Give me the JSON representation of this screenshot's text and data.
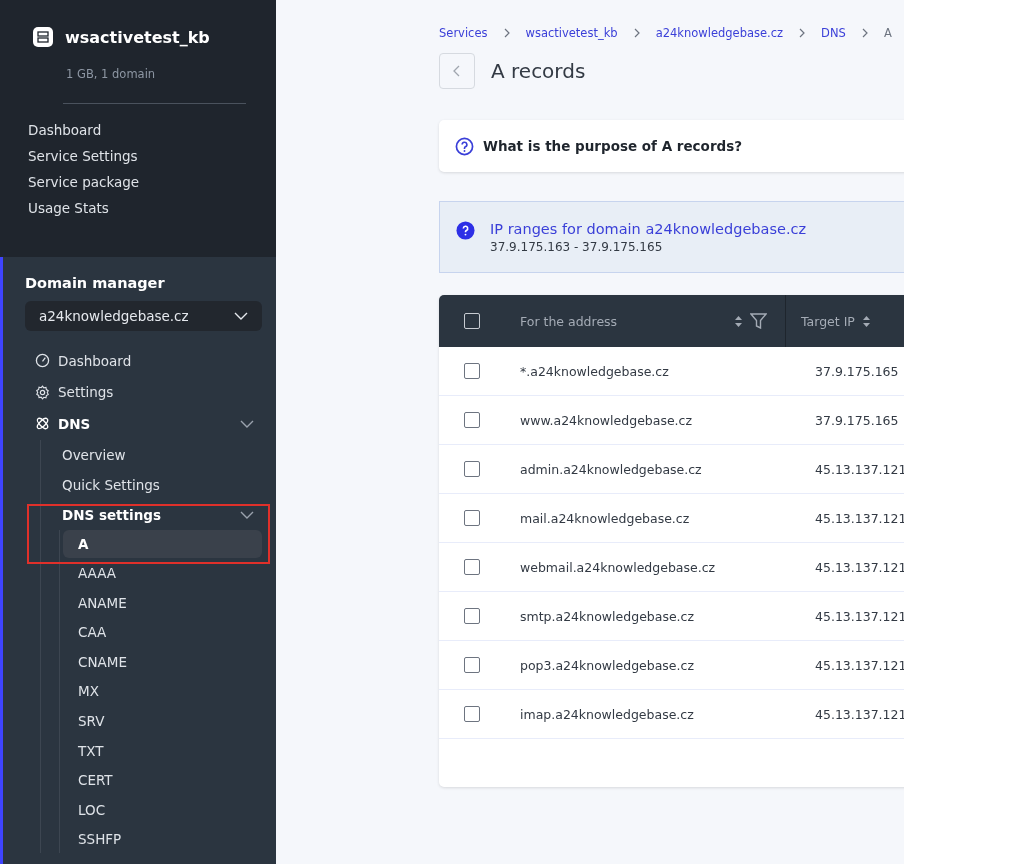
{
  "sidebar": {
    "service": {
      "name": "wsactivetest_kb",
      "subtitle": "1 GB, 1 domain"
    },
    "service_menu": [
      "Dashboard",
      "Service Settings",
      "Service package",
      "Usage Stats"
    ],
    "domain_manager": {
      "title": "Domain manager",
      "domain_select": {
        "value": "a24knowledgebase.cz"
      },
      "nav": [
        {
          "kind": "dashboard",
          "label": "Dashboard"
        },
        {
          "kind": "settings",
          "label": "Settings"
        },
        {
          "kind": "dns",
          "label": "DNS",
          "expanded": true,
          "children": [
            {
              "label": "Overview"
            },
            {
              "label": "Quick Settings"
            },
            {
              "label": "DNS settings",
              "expanded": true,
              "highlighted": true,
              "children": [
                {
                  "label": "A",
                  "selected": true
                },
                {
                  "label": "AAAA",
                  "selected": false
                },
                {
                  "label": "ANAME",
                  "selected": false
                },
                {
                  "label": "CAA",
                  "selected": false
                },
                {
                  "label": "CNAME",
                  "selected": false
                },
                {
                  "label": "MX",
                  "selected": false
                },
                {
                  "label": "SRV",
                  "selected": false
                },
                {
                  "label": "TXT",
                  "selected": false
                },
                {
                  "label": "CERT",
                  "selected": false
                },
                {
                  "label": "LOC",
                  "selected": false
                },
                {
                  "label": "SSHFP",
                  "selected": false
                }
              ]
            }
          ]
        }
      ]
    }
  },
  "breadcrumb": [
    "Services",
    "wsactivetest_kb",
    "a24knowledgebase.cz",
    "DNS",
    "A"
  ],
  "page_title": "A records",
  "faq": {
    "question": "What is the purpose of A records?"
  },
  "info": {
    "title": "IP ranges for domain a24knowledgebase.cz",
    "text": "37.9.175.163 - 37.9.175.165"
  },
  "table": {
    "select_all_checked": false,
    "columns": [
      {
        "label": "For the address",
        "sortable": true,
        "filter": true
      },
      {
        "label": "Target IP",
        "sortable": true,
        "filter": false
      }
    ],
    "rows": [
      {
        "checked": false,
        "cells": [
          "*.a24knowledgebase.cz",
          "37.9.175.165"
        ]
      },
      {
        "checked": false,
        "cells": [
          "www.a24knowledgebase.cz",
          "37.9.175.165"
        ]
      },
      {
        "checked": false,
        "cells": [
          "admin.a24knowledgebase.cz",
          "45.13.137.121"
        ]
      },
      {
        "checked": false,
        "cells": [
          "mail.a24knowledgebase.cz",
          "45.13.137.121"
        ]
      },
      {
        "checked": false,
        "cells": [
          "webmail.a24knowledgebase.cz",
          "45.13.137.121"
        ]
      },
      {
        "checked": false,
        "cells": [
          "smtp.a24knowledgebase.cz",
          "45.13.137.121"
        ]
      },
      {
        "checked": false,
        "cells": [
          "pop3.a24knowledgebase.cz",
          "45.13.137.121"
        ]
      },
      {
        "checked": false,
        "cells": [
          "imap.a24knowledgebase.cz",
          "45.13.137.121"
        ]
      }
    ]
  }
}
